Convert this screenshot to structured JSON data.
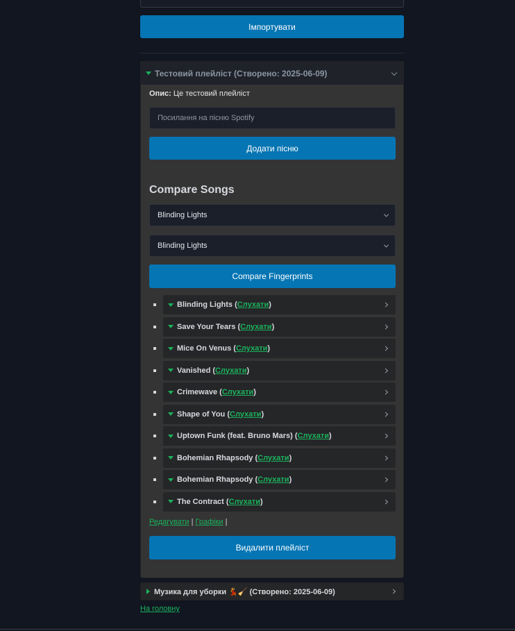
{
  "import_button": "Імпортувати",
  "playlist": {
    "title": "Тестовий плейліст (Створено: 2025-06-09)",
    "description_label": "Опис:",
    "description": "Це тестовий плейліст",
    "song_input_placeholder": "Посилання на пісню Spotify",
    "add_song_button": "Додати пісню",
    "compare_title": "Compare Songs",
    "compare_select_1": "Blinding Lights",
    "compare_select_2": "Blinding Lights",
    "compare_button": "Compare Fingerprints",
    "listen_label": "Слухати",
    "songs": [
      {
        "title": "Blinding Lights"
      },
      {
        "title": "Save Your Tears"
      },
      {
        "title": "Mice On Venus"
      },
      {
        "title": "Vanished"
      },
      {
        "title": "Crimewave"
      },
      {
        "title": "Shape of You"
      },
      {
        "title": "Uptown Funk (feat. Bruno Mars)"
      },
      {
        "title": "Bohemian Rhapsody"
      },
      {
        "title": "Bohemian Rhapsody"
      },
      {
        "title": "The Contract"
      }
    ],
    "edit_link": "Редагувати",
    "charts_link": "Графіки",
    "delete_button": "Видалити плейліст"
  },
  "playlist2": {
    "title": "Музика для уборки 💃🧹 (Створено: 2025-06-09)"
  },
  "home_link": "На головну",
  "colors": {
    "accent_button": "#0675b3",
    "link_green": "#1bb35c",
    "background": "#111621"
  }
}
